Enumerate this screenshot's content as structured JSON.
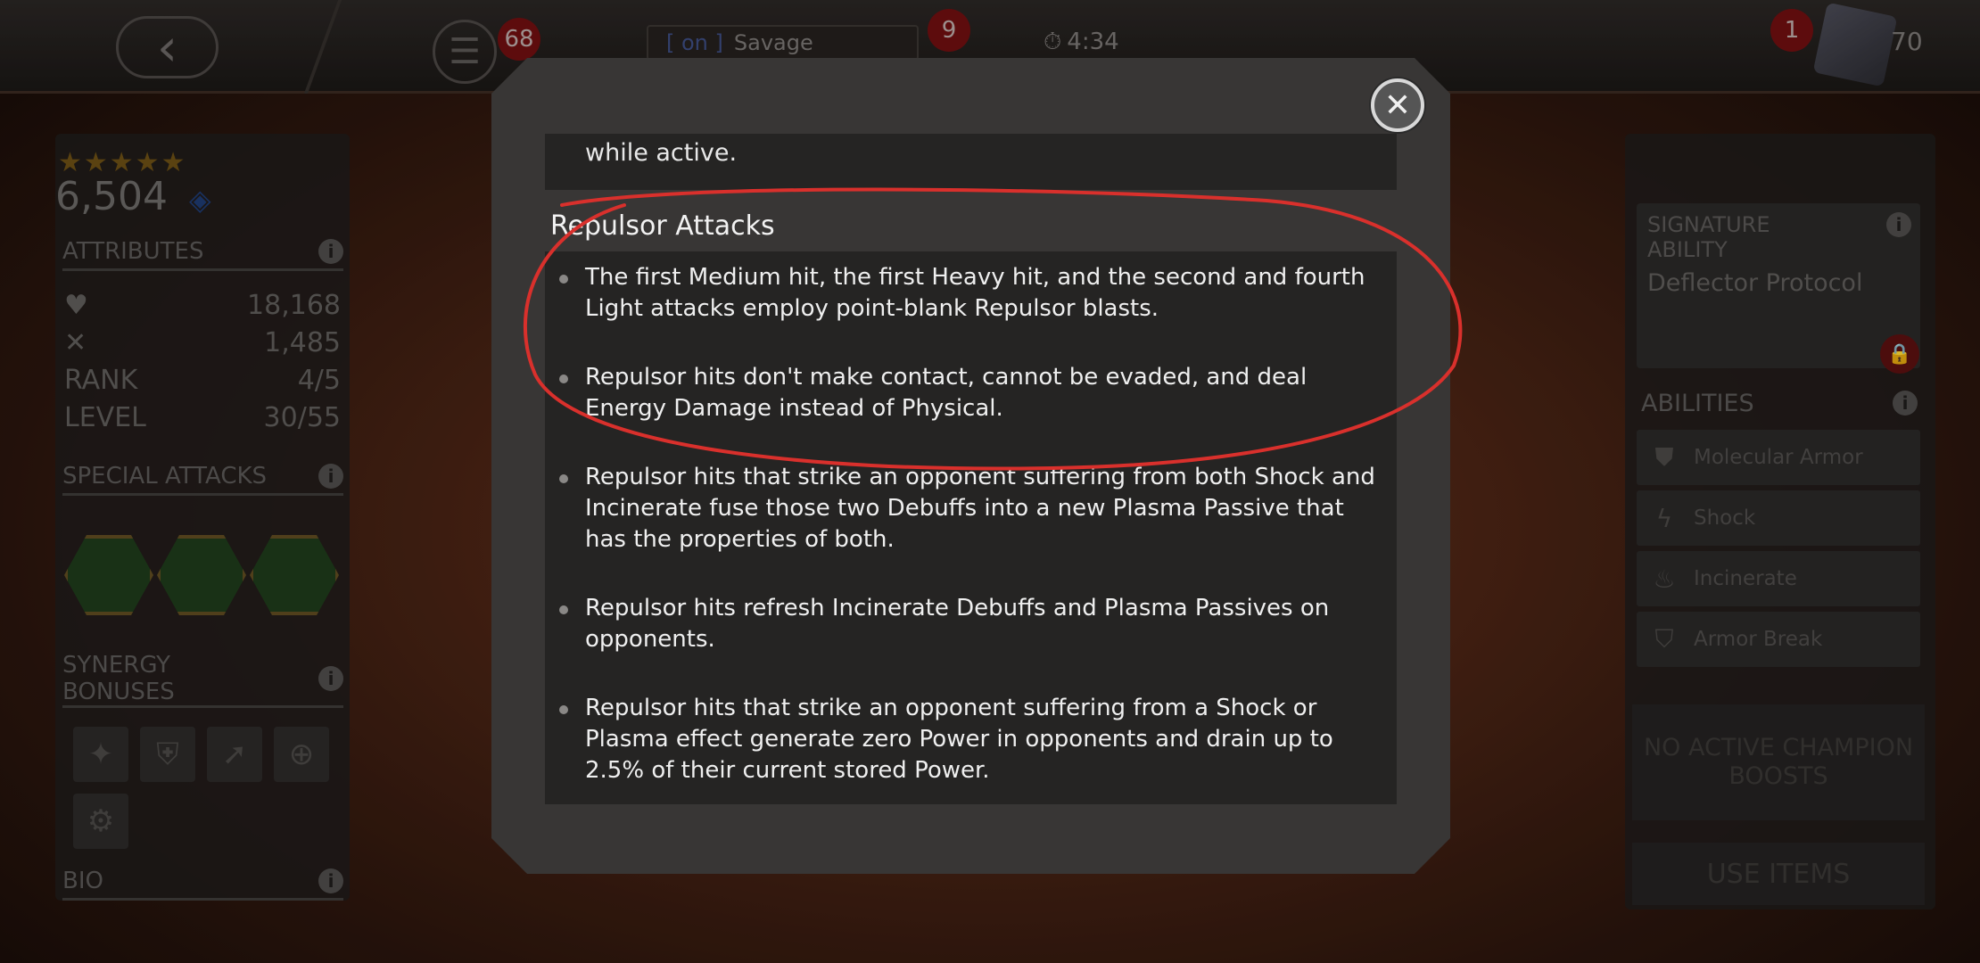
{
  "topbar": {
    "menu_badge": "68",
    "alliance_badge": "9",
    "alliance_tag": "[ on ]",
    "alliance_name": "Savage",
    "timer": "4:34",
    "notify_badge": "1",
    "units": "70"
  },
  "champion": {
    "stars": "★★★★★",
    "rating": "6,504"
  },
  "left_panel": {
    "attributes_label": "ATTRIBUTES",
    "health": "18,168",
    "attack": "1,485",
    "rank_label": "RANK",
    "rank": "4/5",
    "level_label": "LEVEL",
    "level": "30/55",
    "special_attacks_label": "SPECIAL ATTACKS",
    "synergy_label_1": "SYNERGY",
    "synergy_label_2": "BONUSES",
    "bio_label": "BIO"
  },
  "right_panel": {
    "signature_label_1": "SIGNATURE",
    "signature_label_2": "ABILITY",
    "signature_name": "Deflector Protocol",
    "abilities_label": "ABILITIES",
    "abilities": [
      "Molecular Armor",
      "Shock",
      "Incinerate",
      "Armor Break"
    ],
    "boosts_line_1": "NO ACTIVE CHAMPION",
    "boosts_line_2": "BOOSTS",
    "use_items": "USE ITEMS"
  },
  "modal": {
    "prev_text": "while active.",
    "section_title": "Repulsor Attacks",
    "bullets": [
      "The first Medium hit, the first Heavy hit, and the second and fourth Light attacks employ point-blank Repulsor blasts.",
      "Repulsor hits don't make contact, cannot be evaded, and deal Energy Damage instead of Physical.",
      "Repulsor hits that strike an opponent suffering from both Shock and Incinerate fuse those two Debuffs into a new Plasma Passive that has the properties of both.",
      "Repulsor hits refresh Incinerate Debuffs and Plasma Passives on opponents.",
      "Repulsor hits that strike an opponent suffering from a Shock or Plasma effect generate zero Power in opponents and drain up to 2.5% of their current stored Power."
    ],
    "close_icon": "✕"
  },
  "colors": {
    "annotation": "#d9302c"
  }
}
